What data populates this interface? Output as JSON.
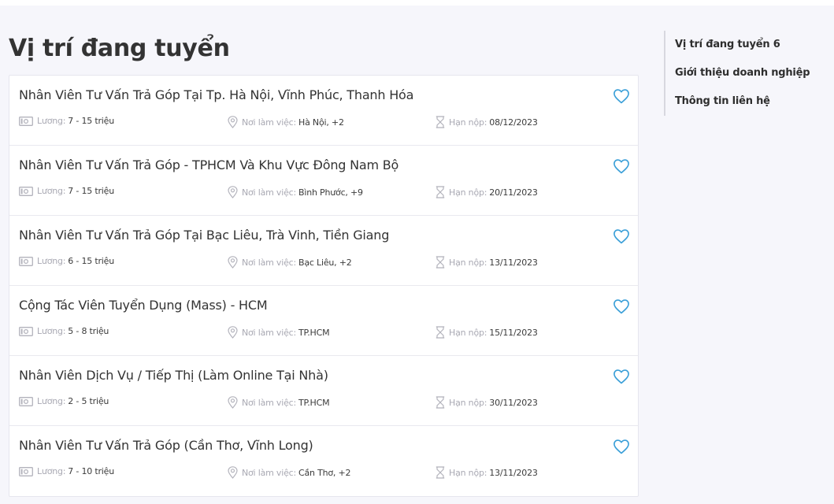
{
  "section_title": "Vị trí đang tuyển",
  "labels": {
    "salary": "Lương:",
    "location": "Nơi làm việc:",
    "deadline": "Hạn nộp:"
  },
  "jobs": [
    {
      "title": "Nhân Viên Tư Vấn Trả Góp Tại Tp. Hà Nội, Vĩnh Phúc, Thanh Hóa",
      "salary": "7 - 15 triệu",
      "location": "Hà Nội, +2",
      "deadline": "08/12/2023"
    },
    {
      "title": "Nhân Viên Tư Vấn Trả Góp - TPHCM Và Khu Vực Đông Nam Bộ",
      "salary": "7 - 15 triệu",
      "location": "Bình Phước, +9",
      "deadline": "20/11/2023"
    },
    {
      "title": "Nhân Viên Tư Vấn Trả Góp Tại Bạc Liêu, Trà Vinh, Tiền Giang",
      "salary": "6 - 15 triệu",
      "location": "Bạc Liêu, +2",
      "deadline": "13/11/2023"
    },
    {
      "title": "Cộng Tác Viên Tuyển Dụng (Mass) - HCM",
      "salary": "5 - 8 triệu",
      "location": "TP.HCM",
      "deadline": "15/11/2023"
    },
    {
      "title": "Nhân Viên Dịch Vụ / Tiếp Thị (Làm Online Tại Nhà)",
      "salary": "2 - 5 triệu",
      "location": "TP.HCM",
      "deadline": "30/11/2023"
    },
    {
      "title": "Nhân Viên Tư Vấn Trả Góp (Cần Thơ, Vĩnh Long)",
      "salary": "7 - 10 triệu",
      "location": "Cần Thơ, +2",
      "deadline": "13/11/2023"
    }
  ],
  "side_nav": [
    {
      "label": "Vị trí đang tuyển 6"
    },
    {
      "label": "Giới thiệu doanh nghiệp"
    },
    {
      "label": "Thông tin liên hệ"
    }
  ],
  "colors": {
    "background": "#f6f6fb",
    "heart": "#3a9fd8",
    "meta_label": "#a9a9b3",
    "text": "#333333"
  },
  "icons": {
    "salary": "money-icon",
    "location": "location-pin-icon",
    "deadline": "hourglass-icon",
    "favorite": "heart-icon"
  }
}
